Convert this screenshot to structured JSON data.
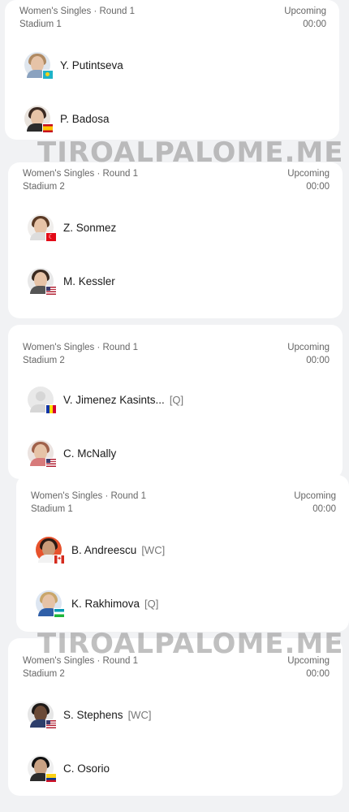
{
  "watermark": "TIROALPALOME.ME",
  "matches": [
    {
      "event": "Women's Singles · Round 1",
      "status": "Upcoming",
      "court": "Stadium 1",
      "time": "00:00",
      "players": [
        {
          "name": "Y. Putintseva",
          "tag": "",
          "flag": "kazakhstan-flag"
        },
        {
          "name": "P. Badosa",
          "tag": "",
          "flag": "spain-flag"
        }
      ]
    },
    {
      "event": "Women's Singles · Round 1",
      "status": "Upcoming",
      "court": "Stadium 2",
      "time": "00:00",
      "players": [
        {
          "name": "Z. Sonmez",
          "tag": "",
          "flag": "turkey-flag"
        },
        {
          "name": "M. Kessler",
          "tag": "",
          "flag": "usa-flag"
        }
      ]
    },
    {
      "event": "Women's Singles · Round 1",
      "status": "Upcoming",
      "court": "Stadium 2",
      "time": "00:00",
      "players": [
        {
          "name": "V. Jimenez Kasints...",
          "tag": "[Q]",
          "flag": "andorra-flag"
        },
        {
          "name": "C. McNally",
          "tag": "",
          "flag": "usa-flag"
        }
      ]
    },
    {
      "event": "Women's Singles · Round 1",
      "status": "Upcoming",
      "court": "Stadium 1",
      "time": "00:00",
      "players": [
        {
          "name": "B. Andreescu",
          "tag": "[WC]",
          "flag": "canada-flag"
        },
        {
          "name": "K. Rakhimova",
          "tag": "[Q]",
          "flag": "uzbekistan-flag"
        }
      ]
    },
    {
      "event": "Women's Singles · Round 1",
      "status": "Upcoming",
      "court": "Stadium 2",
      "time": "00:00",
      "players": [
        {
          "name": "S. Stephens",
          "tag": "[WC]",
          "flag": "usa-flag"
        },
        {
          "name": "C. Osorio",
          "tag": "",
          "flag": "colombia-flag"
        }
      ]
    }
  ]
}
